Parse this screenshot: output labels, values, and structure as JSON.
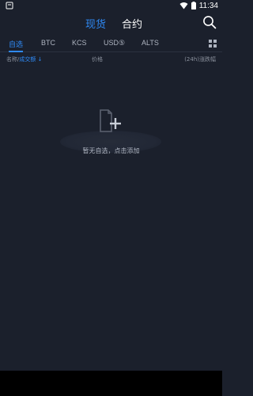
{
  "status_bar": {
    "time": "11:34",
    "icons": [
      "notification-icon",
      "wifi-icon",
      "battery-icon"
    ]
  },
  "top_tabs": {
    "spot": "现货",
    "contract": "合约"
  },
  "sub_tabs": [
    "自选",
    "BTC",
    "KCS",
    "USD⑤",
    "ALTS"
  ],
  "column_headers": {
    "name": "名称/",
    "volume": "成交额",
    "sort_arrow": "↓",
    "price": "价格",
    "change": "(24h)涨跌幅"
  },
  "empty_state": {
    "message": "暂无自选，点击添加"
  },
  "colors": {
    "background": "#1b202c",
    "accent": "#2f8af5"
  }
}
